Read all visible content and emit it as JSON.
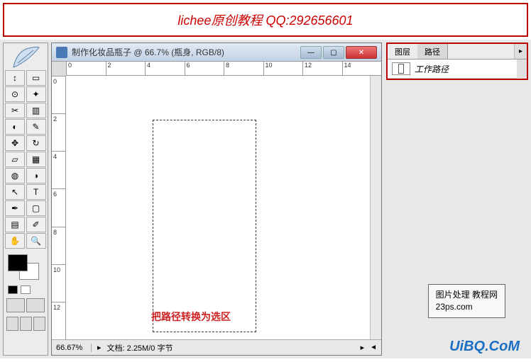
{
  "header": {
    "text": "lichee原创教程 QQ:292656601"
  },
  "document": {
    "title": "制作化妆品瓶子 @ 66.7% (瓶身, RGB/8)",
    "zoom": "66.67%",
    "doc_info": "文档: 2.25M/0 字节",
    "ruler_h": [
      "0",
      "2",
      "4",
      "6",
      "8",
      "10",
      "12",
      "14"
    ],
    "ruler_v": [
      "0",
      "2",
      "4",
      "6",
      "8",
      "10",
      "12"
    ],
    "annotation": "把路径转换为选区"
  },
  "tools": [
    "move-tool",
    "rect-marquee-tool",
    "lasso-tool",
    "magic-wand-tool",
    "crop-tool",
    "slice-tool",
    "healing-brush-tool",
    "brush-tool",
    "clone-stamp-tool",
    "history-brush-tool",
    "eraser-tool",
    "gradient-tool",
    "blur-tool",
    "dodge-tool",
    "path-select-tool",
    "type-tool",
    "pen-tool",
    "rectangle-tool",
    "notes-tool",
    "eyedropper-tool",
    "hand-tool",
    "zoom-tool"
  ],
  "tool_glyphs": [
    "↕",
    "▭",
    "⊙",
    "✦",
    "✂",
    "▥",
    "◐",
    "✎",
    "✥",
    "↻",
    "▱",
    "▦",
    "◍",
    "◑",
    "↖",
    "T",
    "✒",
    "▢",
    "▤",
    "✐",
    "✋",
    "🔍"
  ],
  "panels": {
    "tabs": [
      {
        "label": "图层",
        "active": false
      },
      {
        "label": "路径",
        "active": true
      }
    ],
    "path_item": {
      "name": "工作路径"
    }
  },
  "watermark": {
    "line1": "图片处理 教程网",
    "line2": "23ps.com",
    "brand": "UiBQ.CoM",
    "faint": ""
  },
  "colors": {
    "accent_red": "#c00",
    "brand_blue": "#1a6fc4"
  }
}
